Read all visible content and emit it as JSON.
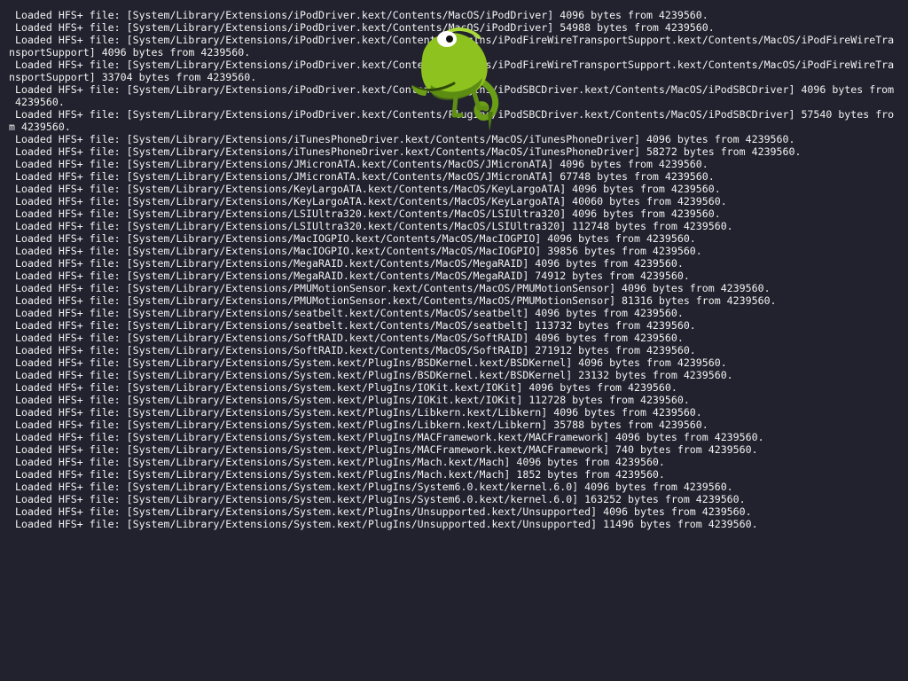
{
  "console": {
    "lines": [
      " Loaded HFS+ file: [System/Library/Extensions/iPodDriver.kext/Contents/MacOS/iPodDriver] 4096 bytes from 4239560.",
      " Loaded HFS+ file: [System/Library/Extensions/iPodDriver.kext/Contents/MacOS/iPodDriver] 54988 bytes from 4239560.",
      " Loaded HFS+ file: [System/Library/Extensions/iPodDriver.kext/Contents/PlugIns/iPodFireWireTransportSupport.kext/Contents/MacOS/iPodFireWireTra",
      "nsportSupport] 4096 bytes from 4239560.",
      " Loaded HFS+ file: [System/Library/Extensions/iPodDriver.kext/Contents/PlugIns/iPodFireWireTransportSupport.kext/Contents/MacOS/iPodFireWireTra",
      "nsportSupport] 33704 bytes from 4239560.",
      " Loaded HFS+ file: [System/Library/Extensions/iPodDriver.kext/Contents/PlugIns/iPodSBCDriver.kext/Contents/MacOS/iPodSBCDriver] 4096 bytes from",
      " 4239560.",
      " Loaded HFS+ file: [System/Library/Extensions/iPodDriver.kext/Contents/PlugIns/iPodSBCDriver.kext/Contents/MacOS/iPodSBCDriver] 57540 bytes fro",
      "m 4239560.",
      " Loaded HFS+ file: [System/Library/Extensions/iTunesPhoneDriver.kext/Contents/MacOS/iTunesPhoneDriver] 4096 bytes from 4239560.",
      " Loaded HFS+ file: [System/Library/Extensions/iTunesPhoneDriver.kext/Contents/MacOS/iTunesPhoneDriver] 58272 bytes from 4239560.",
      " Loaded HFS+ file: [System/Library/Extensions/JMicronATA.kext/Contents/MacOS/JMicronATA] 4096 bytes from 4239560.",
      " Loaded HFS+ file: [System/Library/Extensions/JMicronATA.kext/Contents/MacOS/JMicronATA] 67748 bytes from 4239560.",
      " Loaded HFS+ file: [System/Library/Extensions/KeyLargoATA.kext/Contents/MacOS/KeyLargoATA] 4096 bytes from 4239560.",
      " Loaded HFS+ file: [System/Library/Extensions/KeyLargoATA.kext/Contents/MacOS/KeyLargoATA] 40060 bytes from 4239560.",
      " Loaded HFS+ file: [System/Library/Extensions/LSIUltra320.kext/Contents/MacOS/LSIUltra320] 4096 bytes from 4239560.",
      " Loaded HFS+ file: [System/Library/Extensions/LSIUltra320.kext/Contents/MacOS/LSIUltra320] 112748 bytes from 4239560.",
      " Loaded HFS+ file: [System/Library/Extensions/MacIOGPIO.kext/Contents/MacOS/MacIOGPIO] 4096 bytes from 4239560.",
      " Loaded HFS+ file: [System/Library/Extensions/MacIOGPIO.kext/Contents/MacOS/MacIOGPIO] 39856 bytes from 4239560.",
      " Loaded HFS+ file: [System/Library/Extensions/MegaRAID.kext/Contents/MacOS/MegaRAID] 4096 bytes from 4239560.",
      " Loaded HFS+ file: [System/Library/Extensions/MegaRAID.kext/Contents/MacOS/MegaRAID] 74912 bytes from 4239560.",
      " Loaded HFS+ file: [System/Library/Extensions/PMUMotionSensor.kext/Contents/MacOS/PMUMotionSensor] 4096 bytes from 4239560.",
      " Loaded HFS+ file: [System/Library/Extensions/PMUMotionSensor.kext/Contents/MacOS/PMUMotionSensor] 81316 bytes from 4239560.",
      " Loaded HFS+ file: [System/Library/Extensions/seatbelt.kext/Contents/MacOS/seatbelt] 4096 bytes from 4239560.",
      " Loaded HFS+ file: [System/Library/Extensions/seatbelt.kext/Contents/MacOS/seatbelt] 113732 bytes from 4239560.",
      " Loaded HFS+ file: [System/Library/Extensions/SoftRAID.kext/Contents/MacOS/SoftRAID] 4096 bytes from 4239560.",
      " Loaded HFS+ file: [System/Library/Extensions/SoftRAID.kext/Contents/MacOS/SoftRAID] 271912 bytes from 4239560.",
      " Loaded HFS+ file: [System/Library/Extensions/System.kext/PlugIns/BSDKernel.kext/BSDKernel] 4096 bytes from 4239560.",
      " Loaded HFS+ file: [System/Library/Extensions/System.kext/PlugIns/BSDKernel.kext/BSDKernel] 23132 bytes from 4239560.",
      " Loaded HFS+ file: [System/Library/Extensions/System.kext/PlugIns/IOKit.kext/IOKit] 4096 bytes from 4239560.",
      " Loaded HFS+ file: [System/Library/Extensions/System.kext/PlugIns/IOKit.kext/IOKit] 112728 bytes from 4239560.",
      " Loaded HFS+ file: [System/Library/Extensions/System.kext/PlugIns/Libkern.kext/Libkern] 4096 bytes from 4239560.",
      " Loaded HFS+ file: [System/Library/Extensions/System.kext/PlugIns/Libkern.kext/Libkern] 35788 bytes from 4239560.",
      " Loaded HFS+ file: [System/Library/Extensions/System.kext/PlugIns/MACFramework.kext/MACFramework] 4096 bytes from 4239560.",
      " Loaded HFS+ file: [System/Library/Extensions/System.kext/PlugIns/MACFramework.kext/MACFramework] 740 bytes from 4239560.",
      " Loaded HFS+ file: [System/Library/Extensions/System.kext/PlugIns/Mach.kext/Mach] 4096 bytes from 4239560.",
      " Loaded HFS+ file: [System/Library/Extensions/System.kext/PlugIns/Mach.kext/Mach] 1852 bytes from 4239560.",
      " Loaded HFS+ file: [System/Library/Extensions/System.kext/PlugIns/System6.0.kext/kernel.6.0] 4096 bytes from 4239560.",
      " Loaded HFS+ file: [System/Library/Extensions/System.kext/PlugIns/System6.0.kext/kernel.6.0] 163252 bytes from 4239560.",
      " Loaded HFS+ file: [System/Library/Extensions/System.kext/PlugIns/Unsupported.kext/Unsupported] 4096 bytes from 4239560.",
      " Loaded HFS+ file: [System/Library/Extensions/System.kext/PlugIns/Unsupported.kext/Unsupported] 11496 bytes from 4239560."
    ]
  },
  "mascot": {
    "icon": "chameleon-icon",
    "color_body": "#8dc21f",
    "color_shadow": "#4d7a10"
  },
  "colors": {
    "background": "#22222f",
    "text": "#f2f2f2"
  }
}
